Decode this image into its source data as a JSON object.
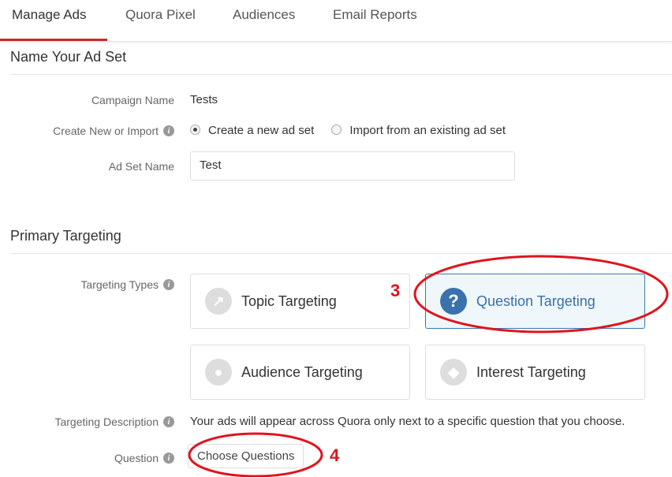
{
  "tabs": [
    {
      "label": "Manage Ads",
      "active": true
    },
    {
      "label": "Quora Pixel"
    },
    {
      "label": "Audiences"
    },
    {
      "label": "Email Reports"
    }
  ],
  "name_section": {
    "title": "Name Your Ad Set",
    "campaign_label": "Campaign Name",
    "campaign_value": "Tests",
    "create_label": "Create New or Import",
    "option_new": "Create a new ad set",
    "option_import": "Import from an existing ad set",
    "selected": "Create a new ad set",
    "adset_label": "Ad Set Name",
    "adset_value": "Test"
  },
  "targeting_section": {
    "title": "Primary Targeting",
    "types_label": "Targeting Types",
    "types": [
      {
        "label": "Topic Targeting",
        "icon": "trend-icon"
      },
      {
        "label": "Question Targeting",
        "icon": "question-icon",
        "selected": true
      },
      {
        "label": "Audience Targeting",
        "icon": "people-icon"
      },
      {
        "label": "Interest Targeting",
        "icon": "diamond-icon"
      }
    ],
    "description_label": "Targeting Description",
    "description": "Your ads will appear across Quora only next to a specific question that you choose.",
    "question_label": "Question",
    "choose_button": "Choose Questions"
  },
  "annotations": {
    "step3": "3",
    "step4": "4",
    "color": "#e0141e"
  },
  "colors": {
    "accent": "#c82a2a",
    "selected": "#3a72ad"
  }
}
